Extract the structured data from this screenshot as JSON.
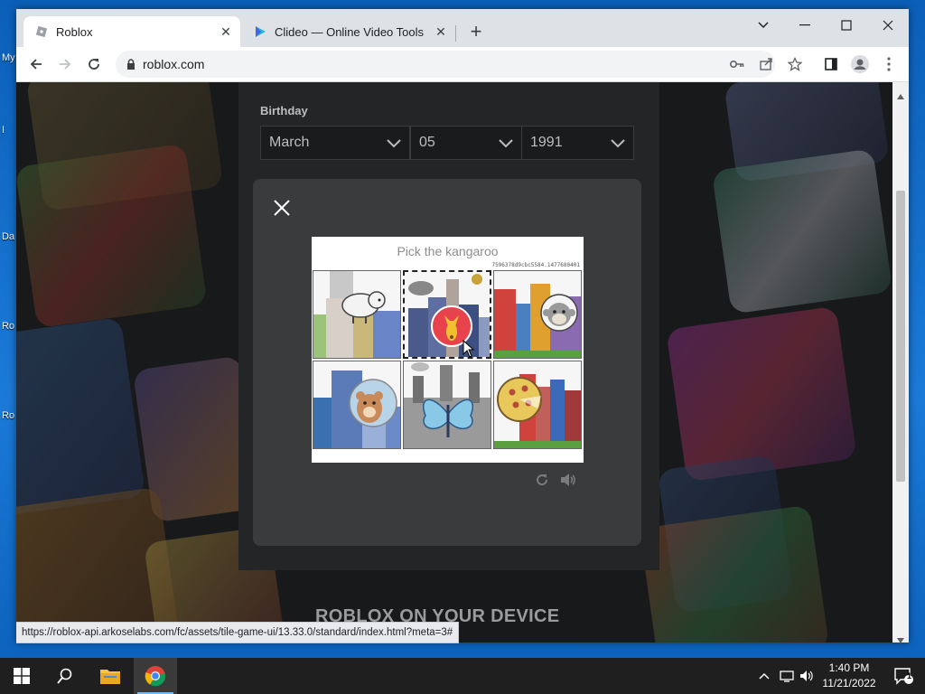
{
  "desktop": {
    "labels": [
      "My",
      "I",
      "Da",
      "Ro",
      "Ro"
    ]
  },
  "browser": {
    "tabs": [
      {
        "title": "Roblox",
        "icon": "roblox-favicon"
      },
      {
        "title": "Clideo — Online Video Tools",
        "icon": "clideo-favicon"
      }
    ],
    "url": "roblox.com",
    "status_url": "https://roblox-api.arkoselabs.com/fc/assets/tile-game-ui/13.33.0/standard/index.html?meta=3#"
  },
  "page": {
    "birthday_label": "Birthday",
    "month": "March",
    "day": "05",
    "year": "1991",
    "footer_text": "ROBLOX ON YOUR DEVICE"
  },
  "captcha": {
    "prompt": "Pick the kangaroo",
    "session_id": "7596378d9cbc5584.1477680401",
    "tiles": [
      "sheep",
      "kangaroo",
      "monkey",
      "hamster",
      "butterfly",
      "pizza"
    ],
    "selected_index": 1
  },
  "taskbar": {
    "time": "1:40 PM",
    "date": "11/21/2022",
    "notification_count": "1"
  },
  "colors": {
    "accent": "#76b9ed",
    "modal_bg": "#393b3d",
    "kangaroo": "#e8434c"
  }
}
